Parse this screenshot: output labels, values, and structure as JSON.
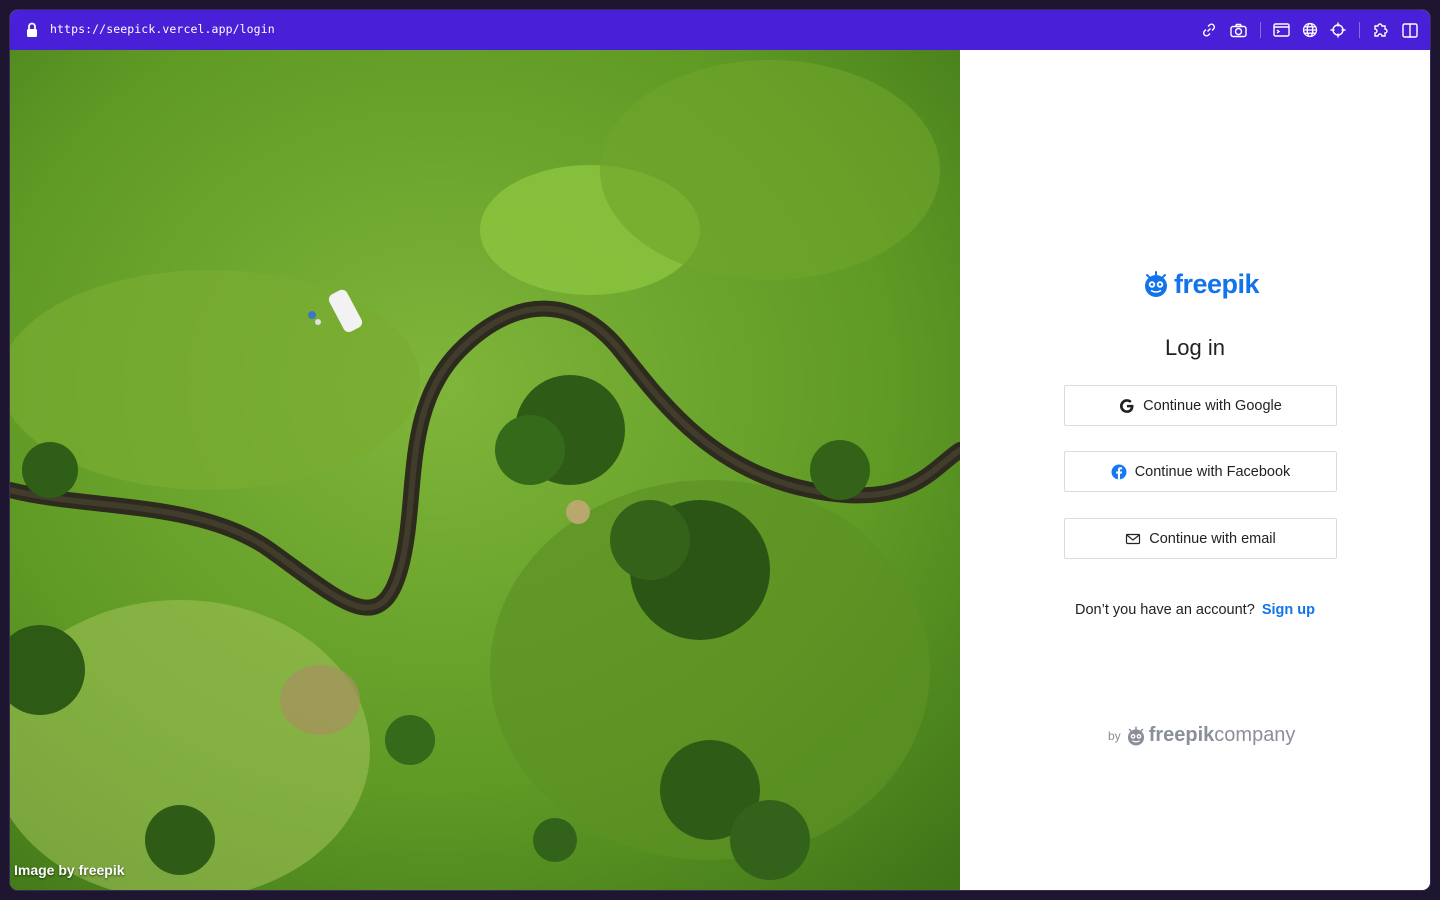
{
  "browser": {
    "url": "https://seepick.vercel.app/login",
    "toolbar_icons": [
      "link-icon",
      "camera-icon",
      "terminal-icon",
      "globe-icon",
      "crosshair-icon",
      "extension-icon",
      "sidebar-icon"
    ],
    "accent_color": "#4a1fd8"
  },
  "hero": {
    "credit": "Image by freepik"
  },
  "login": {
    "logo_text": "freepik",
    "title": "Log in",
    "google_label": "Continue with Google",
    "facebook_label": "Continue with Facebook",
    "email_label": "Continue with email",
    "signup_prompt": "Don’t you have an account?",
    "signup_link": "Sign up",
    "footer_by": "by",
    "footer_brand_bold": "freepik",
    "footer_brand_light": "company",
    "brand_color": "#1273eb"
  }
}
